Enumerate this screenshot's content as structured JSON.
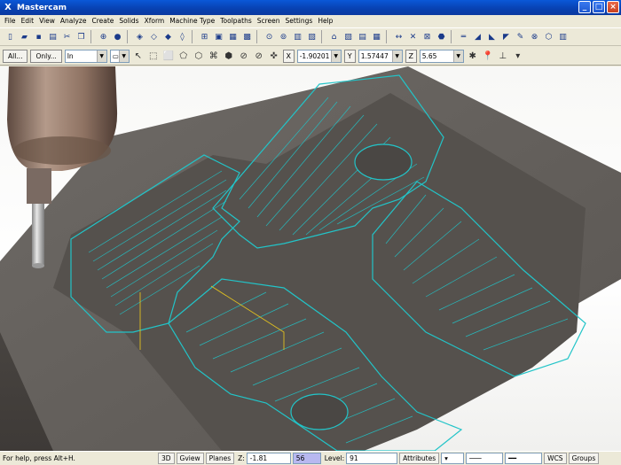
{
  "window": {
    "title": "Mastercam"
  },
  "menu": [
    "File",
    "Edit",
    "View",
    "Analyze",
    "Create",
    "Solids",
    "Xform",
    "Machine Type",
    "Toolpaths",
    "Screen",
    "Settings",
    "Help"
  ],
  "inputbar": {
    "all_label": "All...",
    "only_label": "Only...",
    "selection_mode": "In",
    "x_label": "X",
    "x_value": "-1.90201",
    "y_label": "Y",
    "y_value": "1.57447",
    "z_label": "Z",
    "z_value": "5.65"
  },
  "status": {
    "help_text": "For help, press Alt+H.",
    "view_3d": "3D",
    "gview": "Gview",
    "planes": "Planes",
    "z_label": "Z:",
    "z_value": "-1.81",
    "color_value": "56",
    "level_label": "Level:",
    "level_value": "91",
    "attributes": "Attributes",
    "wcs": "WCS",
    "groups": "Groups"
  },
  "colors": {
    "toolpath": "#22c4c8",
    "stock": "#6a6560",
    "part": "#a8a6a2",
    "spindle": "#8a6e60"
  }
}
